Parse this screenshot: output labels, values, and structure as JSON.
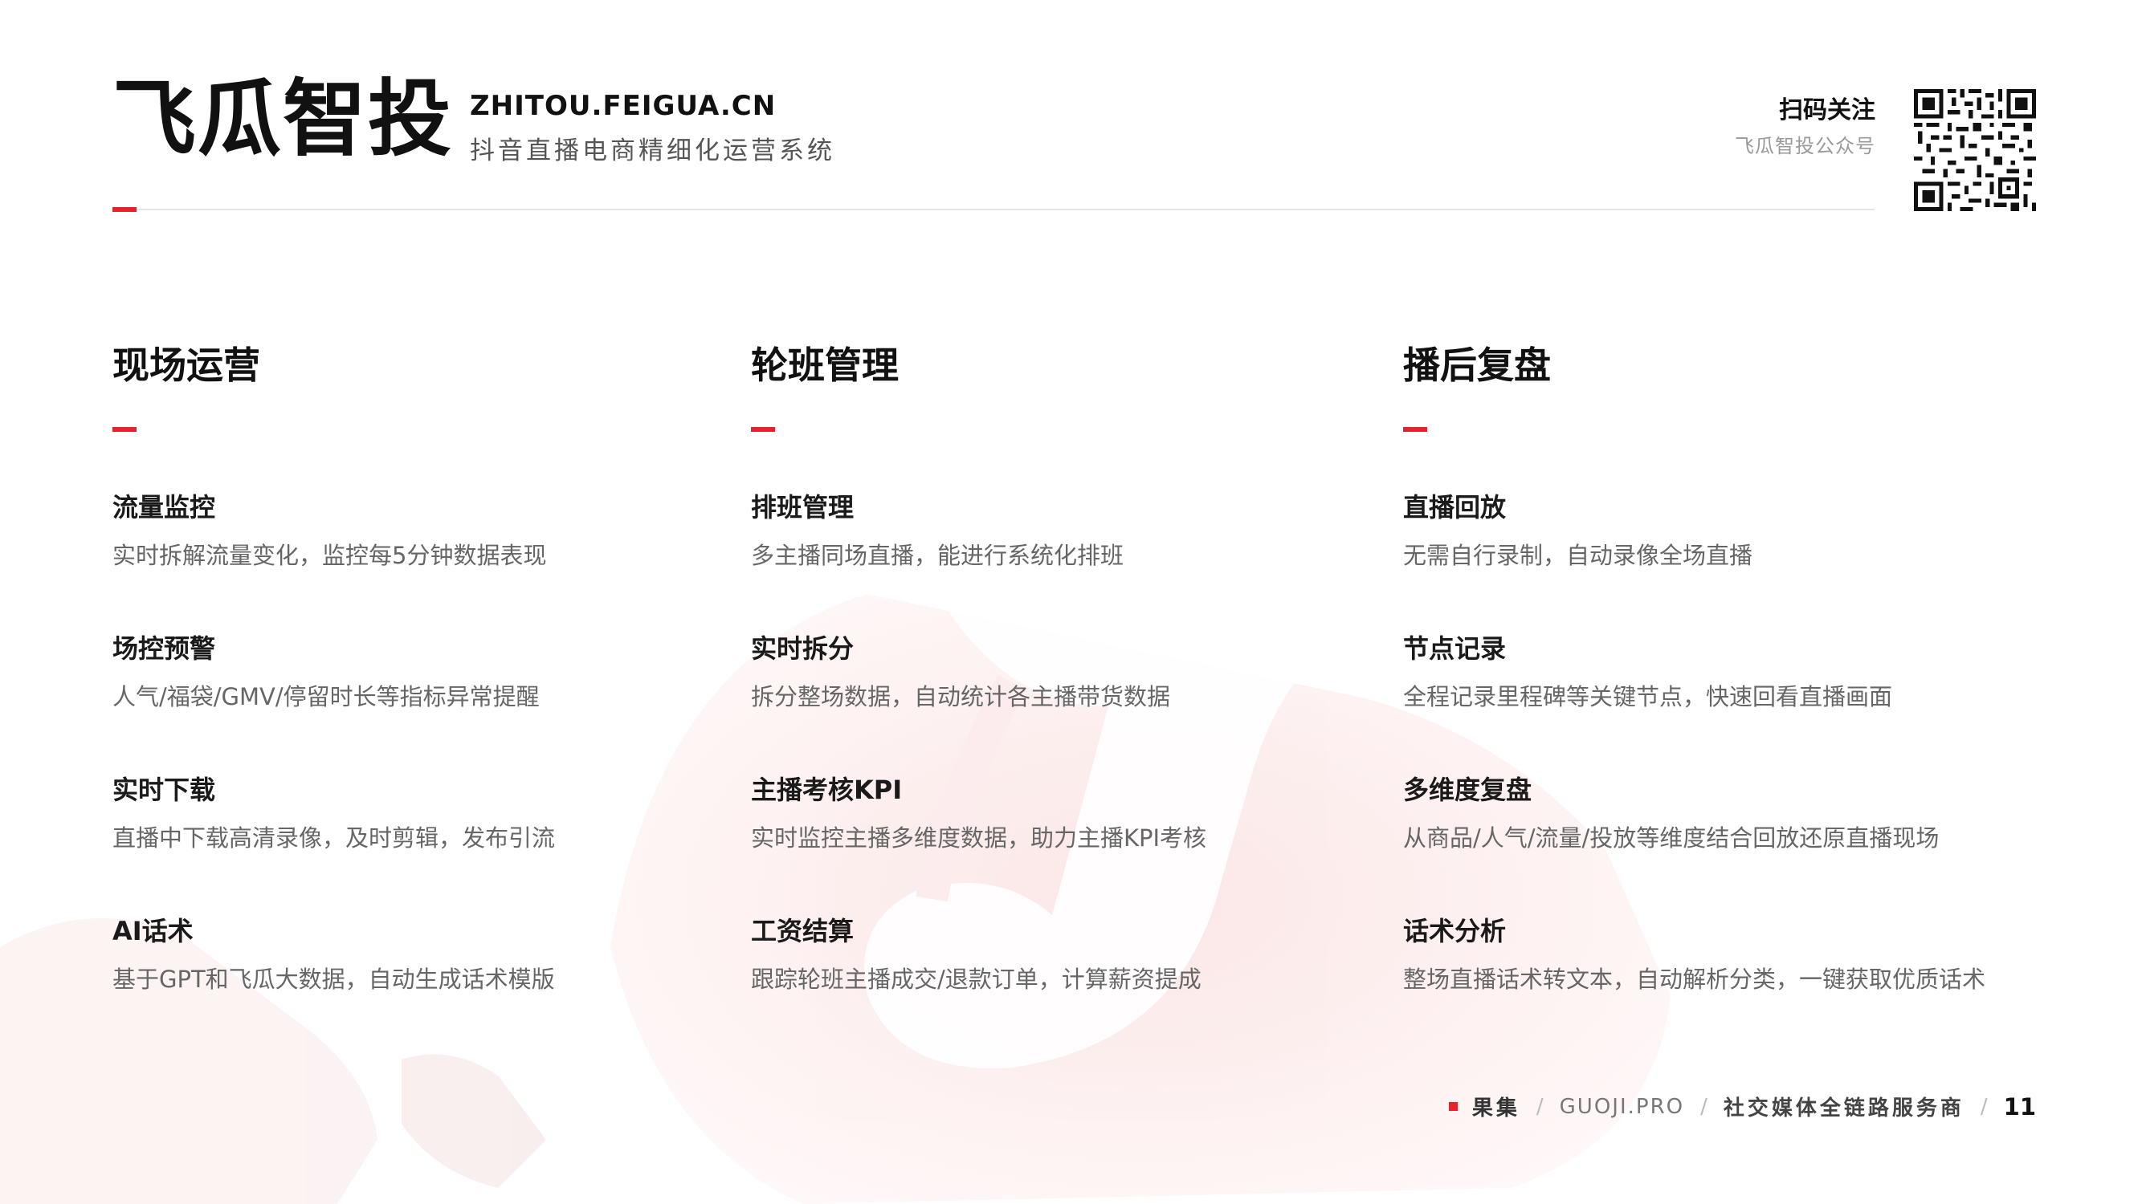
{
  "header": {
    "brand": "飞瓜智投",
    "domain": "ZHITOU.FEIGUA.CN",
    "tagline": "抖音直播电商精细化运营系统",
    "scan_title": "扫码关注",
    "scan_subtitle": "飞瓜智投公众号",
    "qr_icon": "qr-code-icon"
  },
  "columns": [
    {
      "title": "现场运营",
      "items": [
        {
          "title": "流量监控",
          "desc": "实时拆解流量变化，监控每5分钟数据表现"
        },
        {
          "title": "场控预警",
          "desc": "人气/福袋/GMV/停留时长等指标异常提醒"
        },
        {
          "title": "实时下载",
          "desc": "直播中下载高清录像，及时剪辑，发布引流"
        },
        {
          "title": "AI话术",
          "desc": "基于GPT和飞瓜大数据，自动生成话术模版"
        }
      ]
    },
    {
      "title": "轮班管理",
      "items": [
        {
          "title": "排班管理",
          "desc": "多主播同场直播，能进行系统化排班"
        },
        {
          "title": "实时拆分",
          "desc": "拆分整场数据，自动统计各主播带货数据"
        },
        {
          "title": "主播考核KPI",
          "desc": "实时监控主播多维度数据，助力主播KPI考核"
        },
        {
          "title": "工资结算",
          "desc": "跟踪轮班主播成交/退款订单，计算薪资提成"
        }
      ]
    },
    {
      "title": "播后复盘",
      "items": [
        {
          "title": "直播回放",
          "desc": "无需自行录制，自动录像全场直播"
        },
        {
          "title": "节点记录",
          "desc": "全程记录里程碑等关键节点，快速回看直播画面"
        },
        {
          "title": "多维度复盘",
          "desc": "从商品/人气/流量/投放等维度结合回放还原直播现场"
        },
        {
          "title": "话术分析",
          "desc": "整场直播话术转文本，自动解析分类，一键获取优质话术"
        }
      ]
    }
  ],
  "footer": {
    "brand": "果集",
    "site": "GUOJI.PRO",
    "slogan": "社交媒体全链路服务商",
    "separator": "/",
    "page": "11"
  },
  "colors": {
    "accent": "#e5232f",
    "text": "#1a1a1a",
    "muted": "#666666"
  }
}
